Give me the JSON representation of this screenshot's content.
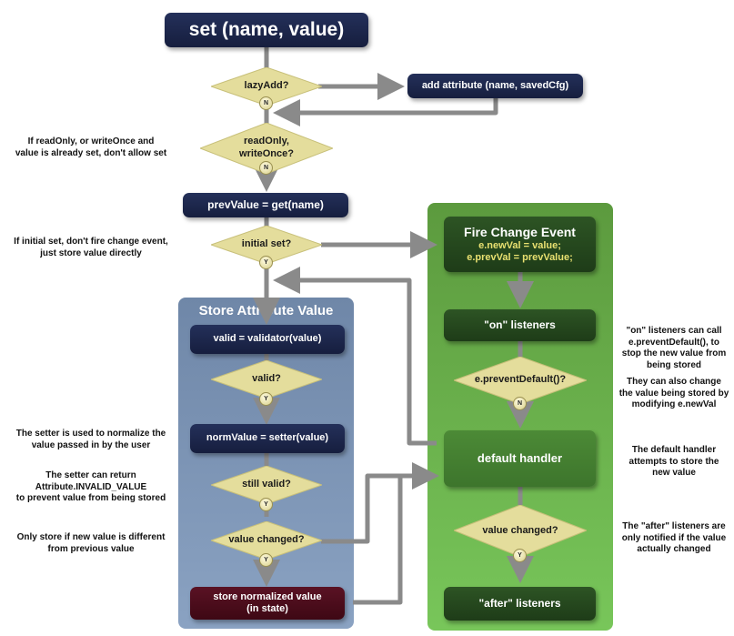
{
  "title_box": "set (name, value)",
  "nodes": {
    "lazy_add": "lazyAdd?",
    "add_attribute": "add attribute (name, savedCfg)",
    "read_only": "readOnly,\nwriteOnce?",
    "prev_value": "prevValue = get(name)",
    "initial_set": "initial set?",
    "valid_call": "valid = validator(value)",
    "valid_q": "valid?",
    "norm_value": "normValue = setter(value)",
    "still_valid": "still valid?",
    "value_changed_store": "value changed?",
    "store_normalized": "store normalized value\n(in state)",
    "fire_change_title": "Fire Change Event",
    "fire_change_line1": "e.newVal = value;",
    "fire_change_line2": "e.prevVal = prevValue;",
    "on_listeners": "\"on\" listeners",
    "prevent_default": "e.preventDefault()?",
    "default_handler": "default handler",
    "value_changed_event": "value changed?",
    "after_listeners": "\"after\" listeners"
  },
  "containers": {
    "store": "Store Attribute Value"
  },
  "badges": {
    "lazy_add": "N",
    "read_only": "N",
    "initial_set": "Y",
    "valid_q": "Y",
    "still_valid": "Y",
    "value_changed_store": "Y",
    "prevent_default": "N",
    "value_changed_event": "Y"
  },
  "notes": {
    "read_only": "If readOnly, or writeOnce and\nvalue is already set, don't allow set",
    "initial_set": "If initial set, don't fire change event,\njust store value directly",
    "setter": "The setter is used to normalize the\nvalue passed in by the user",
    "invalid": "The setter can return\nAttribute.INVALID_VALUE\nto prevent value from being stored",
    "only_store": "Only store if new value is different\nfrom previous value",
    "on_listeners": "\"on\" listeners can call\ne.preventDefault(), to\nstop the new value from\nbeing stored",
    "change_value": "They can also change\nthe value being stored by\nmodifying e.newVal",
    "default_handler": "The default handler\nattempts to store the\nnew value",
    "after_listeners": "The \"after\" listeners are\nonly notified if the value\nactually changed"
  },
  "colors": {
    "navy": "#1b2448",
    "diamond": "#e4dd9c",
    "connector": "#8a8a8a",
    "store_container": "#7b93b4",
    "event_container": "#6aae4c",
    "dark_green": "#254a1e",
    "maroon": "#4a0c1a",
    "code_text": "#e8e070"
  }
}
